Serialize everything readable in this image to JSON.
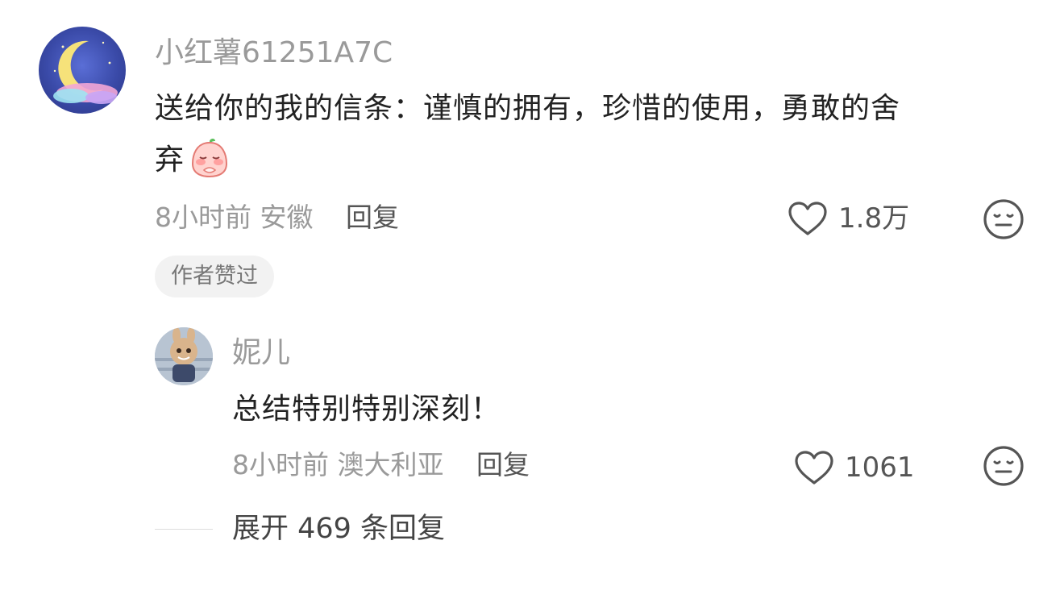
{
  "comment": {
    "username": "小红薯61251A7C",
    "text_line1": "送给你的我的信条：谨慎的拥有，珍惜的使用，勇敢的舍",
    "text_line2": "弃",
    "emoji_icon": "blushing-peach-emoji",
    "time": "8小时前",
    "location": "安徽",
    "reply_label": "回复",
    "likes": "1.8万",
    "badge": "作者赞过"
  },
  "reply": {
    "username": "妮儿",
    "text": "总结特别特别深刻！",
    "time": "8小时前",
    "location": "澳大利亚",
    "reply_label": "回复",
    "likes": "1061"
  },
  "expand_label": "展开 469 条回复",
  "icons": {
    "like": "heart-outline-icon",
    "dislike": "neutral-face-icon"
  },
  "colors": {
    "text_primary": "#222222",
    "text_secondary": "#9a9a9a",
    "badge_bg": "#f2f2f2"
  }
}
